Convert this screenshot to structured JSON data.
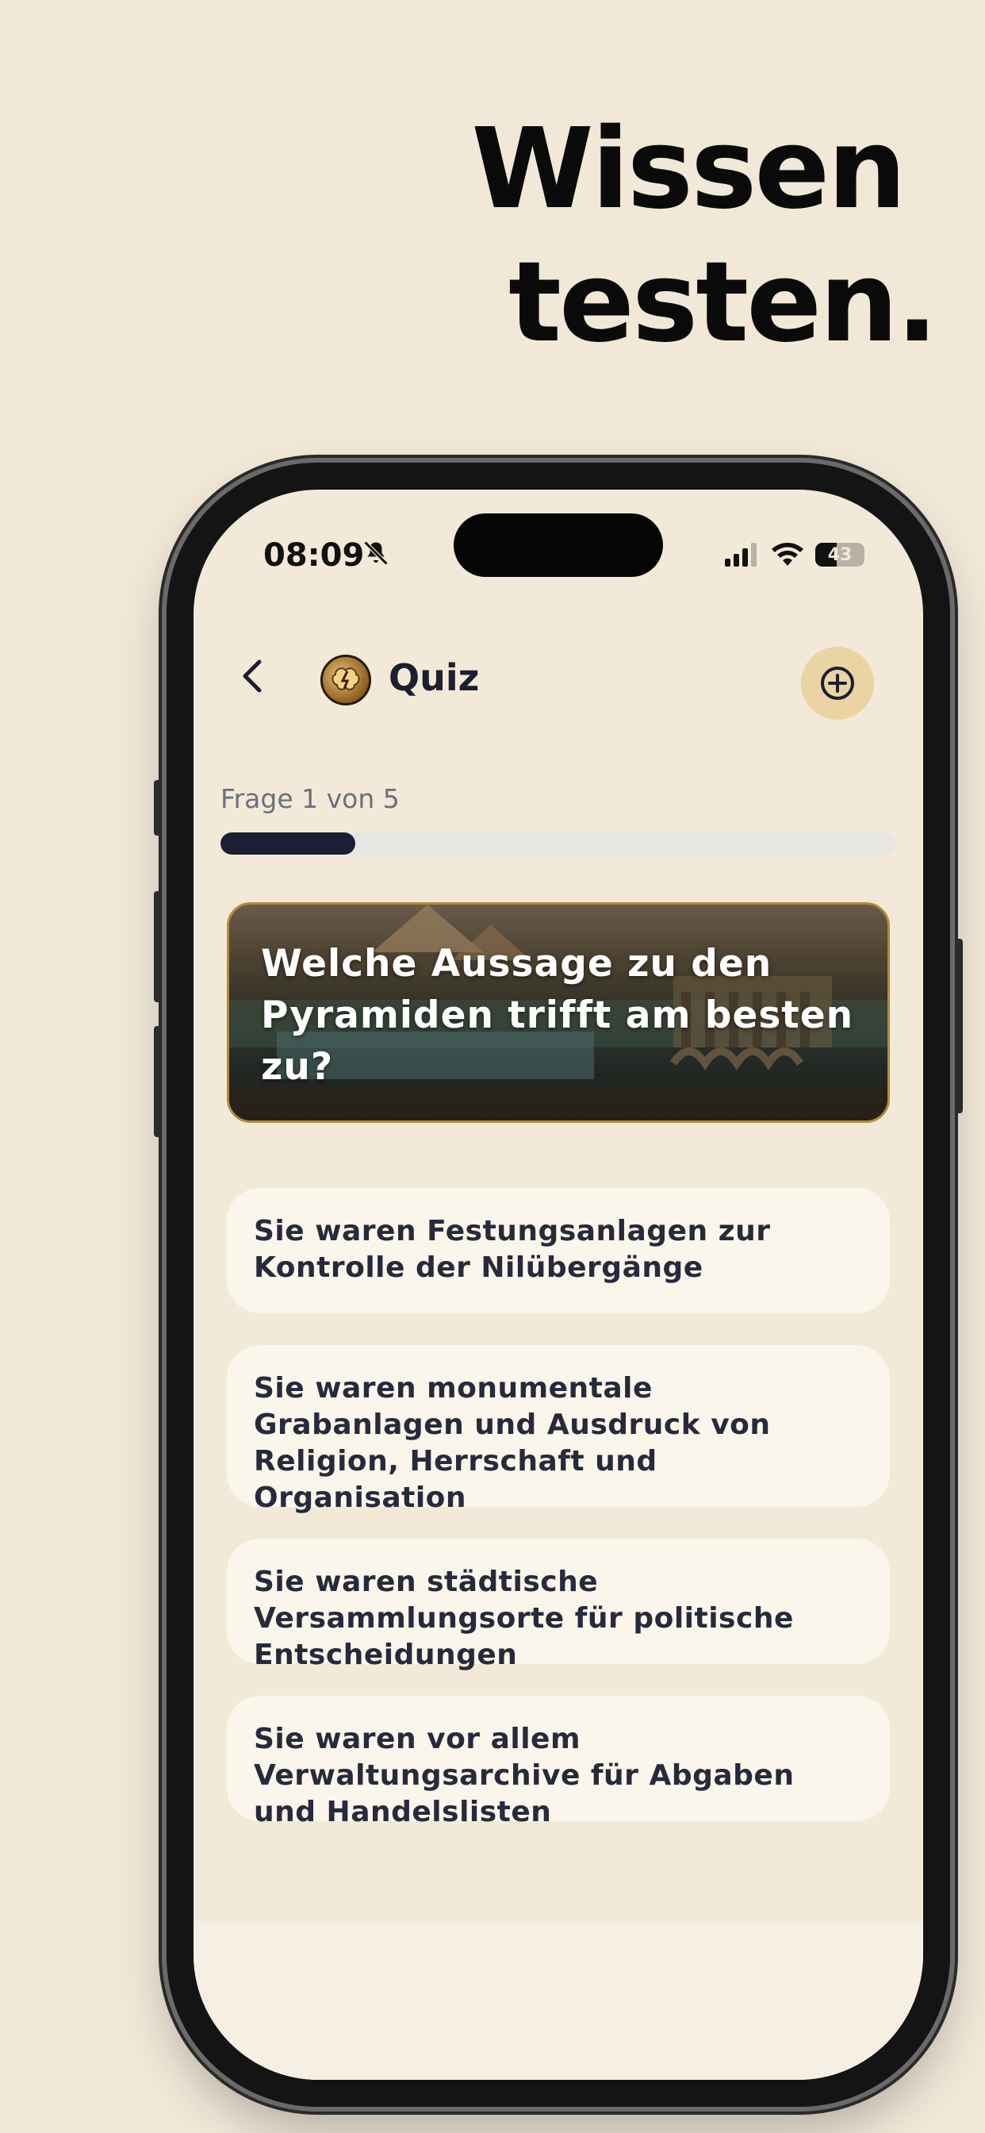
{
  "headline": {
    "line1": "Wissen",
    "line2": "testen."
  },
  "status_bar": {
    "time": "08:09",
    "battery": "43",
    "battery_level": 0.43,
    "icons": [
      "bell-slash-icon",
      "signal-icon",
      "wifi-icon",
      "battery-icon"
    ]
  },
  "nav": {
    "back_icon": "chevron-left-icon",
    "title": "Quiz",
    "add_icon": "plus-circle-icon"
  },
  "progress": {
    "label": "Frage 1 von 5",
    "value": 0.2
  },
  "question": {
    "text": "Welche Aussage zu den Pyramiden trifft am besten zu?"
  },
  "answers": [
    {
      "text": "Sie waren Festungsanlagen zur Kontrolle der Nilübergänge"
    },
    {
      "text": "Sie waren monumentale Grabanlagen und Ausdruck von Religion, Herrschaft und Organisation"
    },
    {
      "text": "Sie waren städtische Versammlungsorte für politische Entscheidungen"
    },
    {
      "text": "Sie waren vor allem Verwaltungsarchive für Abgaben und Handelslisten"
    }
  ],
  "colors": {
    "background": "#f1e8d8",
    "accent": "#1b1f33",
    "add_button": "#ebd4a3",
    "card_border": "#b08a3e"
  }
}
